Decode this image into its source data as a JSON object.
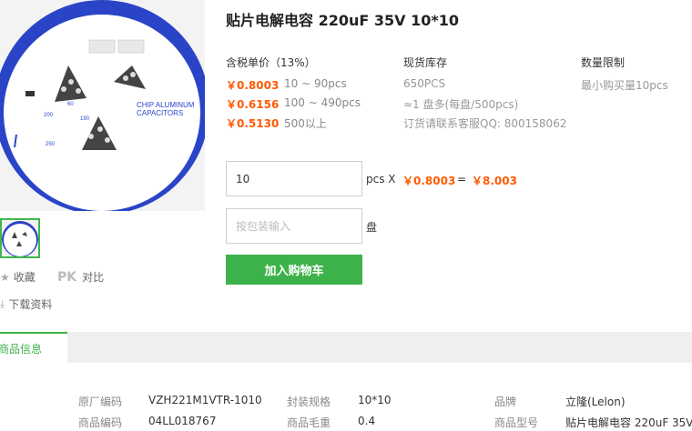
{
  "product": {
    "title": "贴片电解电容 220uF 35V 10*10",
    "image": {
      "reel_text_line1": "CHIP ALUMINUM",
      "reel_text_line2": "CAPACITORS",
      "dim_a": "200",
      "dim_b": "250",
      "dim_c": "190",
      "dim_d": "60"
    }
  },
  "pricing": {
    "header": "含税单价（13%）",
    "tiers": [
      {
        "price": "￥0.8003",
        "range": "10 ~ 90pcs"
      },
      {
        "price": "￥0.6156",
        "range": "100 ~ 490pcs"
      },
      {
        "price": "￥0.5130",
        "range": "500以上"
      }
    ]
  },
  "stock": {
    "header": "现货库存",
    "quantity": "650PCS",
    "reels": "≈1 盘多(每盘/500pcs)",
    "contact": "订货请联系客服QQ: 800158062"
  },
  "limit": {
    "header": "数量限制",
    "text": "最小购买量10pcs"
  },
  "order": {
    "qty_value": "10",
    "unit": "pcs X",
    "unit_price": "￥0.8003",
    "equals": "=",
    "total": "￥8.003",
    "reel_placeholder": "按包装输入",
    "reel_unit": "盘",
    "add_to_cart": "加入购物车"
  },
  "actions": {
    "favorite": "收藏",
    "pk": "PK",
    "compare": "对比",
    "download": "下载资料"
  },
  "tabs": {
    "info": "商品信息"
  },
  "info": {
    "rows": [
      [
        {
          "label": "原厂编码",
          "value": "VZH221M1VTR-1010"
        },
        {
          "label": "封装规格",
          "value": "10*10"
        },
        {
          "label": "品牌",
          "value": "立隆(Lelon)"
        }
      ],
      [
        {
          "label": "商品编码",
          "value": "04LL018767"
        },
        {
          "label": "商品毛重",
          "value": "0.4"
        },
        {
          "label": "商品型号",
          "value": "贴片电解电容 220uF 35V"
        }
      ]
    ]
  },
  "colors": {
    "accent_green": "#3eb24a",
    "price_orange": "#ff5a00",
    "reel_blue": "#2a44c8"
  }
}
